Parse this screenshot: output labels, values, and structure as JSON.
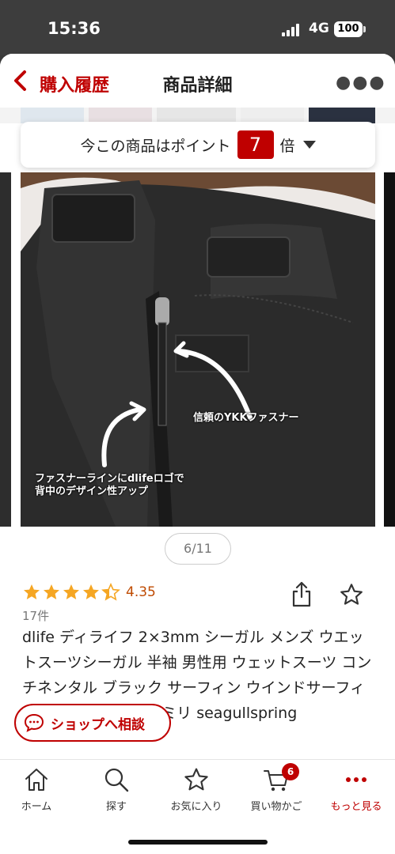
{
  "status": {
    "time": "15:36",
    "network": "4G",
    "battery": "100"
  },
  "nav": {
    "back_label": "購入履歴",
    "title": "商品詳細"
  },
  "points": {
    "text": "今この商品はポイント",
    "multiplier": "7",
    "suffix": "倍"
  },
  "gallery": {
    "callout_zipper": "信頼のYKKファスナー",
    "callout_logo_line1": "ファスナーラインにdlifeロゴで",
    "callout_logo_line2": "背中のデザイン性アップ",
    "counter": "6/11"
  },
  "product": {
    "rating": 4.35,
    "rating_text": "4.35",
    "review_count": "17件",
    "title": "dlife ディライフ 2×3mm シーガル メンズ ウエットスーツシーガル 半袖 男性用 ウェットスーツ コンチネンタル ブラック サーフィン ウインドサーフィン ジェットスキー 3ミリ seagullspring"
  },
  "consult": {
    "label": "ショップへ相談"
  },
  "tabs": [
    {
      "label": "ホーム",
      "icon": "home-icon"
    },
    {
      "label": "探す",
      "icon": "search-icon"
    },
    {
      "label": "お気に入り",
      "icon": "star-icon"
    },
    {
      "label": "買い物かご",
      "icon": "cart-icon",
      "badge": "6"
    },
    {
      "label": "もっと見る",
      "icon": "more-dots-icon",
      "active": true
    }
  ],
  "colors": {
    "accent": "#bf0000",
    "star": "#f5a623"
  }
}
